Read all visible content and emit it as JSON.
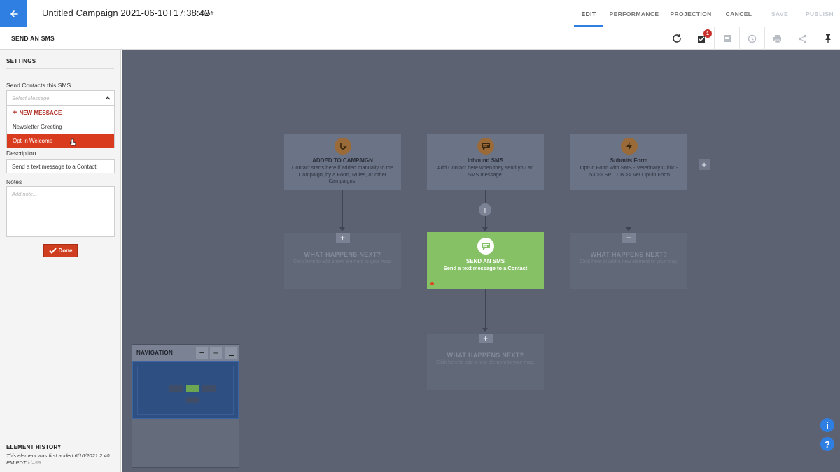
{
  "header": {
    "campaign_title": "Untitled Campaign 2021-06-10T17:38:42",
    "status": "Draft",
    "nav": {
      "edit": "EDIT",
      "performance": "PERFORMANCE",
      "projection": "PROJECTION",
      "cancel": "CANCEL",
      "save": "SAVE",
      "publish": "PUBLISH"
    },
    "accent_color": "#2f7fe3"
  },
  "subbar": {
    "title": "SEND AN SMS",
    "tasks_badge": "1"
  },
  "panel": {
    "settings_heading": "SETTINGS",
    "send_label": "Send Contacts this SMS",
    "select_placeholder": "Select Message",
    "dropdown": {
      "new_message": "NEW MESSAGE",
      "options": [
        "Newsletter Greeting",
        "Opt-in Welcome"
      ],
      "selected": "Opt-in Welcome"
    },
    "description_label": "Description",
    "description_value": "Send a text message to a Contact",
    "notes_label": "Notes",
    "notes_placeholder": "Add note...",
    "done_label": "Done",
    "history_heading": "ELEMENT HISTORY",
    "history_text": "This element was first added 6/10/2021 2:40 PM PDT",
    "history_id": "id=59"
  },
  "canvas": {
    "nodes": {
      "added": {
        "title": "ADDED TO CAMPAIGN",
        "desc": "Contact starts here if added manually to the Campaign, by a Form, Rules, or other Campaigns.",
        "icon": "flag-arrow-icon"
      },
      "inbound": {
        "title": "Inbound SMS",
        "desc": "Add Contact here when they send you an SMS message.",
        "icon": "sms-chat-icon"
      },
      "submits": {
        "title": "Submits Form",
        "desc": "Opt-In Form with SMS - Veterinary Clinic - 053 >> SPLIT B >> Vet Opt-in Form.",
        "icon": "lightning-icon"
      },
      "send_sms": {
        "title": "SEND AN SMS",
        "desc": "Send a text message to a Contact",
        "icon": "sms-chat-icon"
      },
      "empty": {
        "title": "WHAT HAPPENS NEXT?",
        "desc": "Click here to add a new element to your map."
      }
    },
    "navigation": {
      "title": "NAVIGATION"
    }
  }
}
